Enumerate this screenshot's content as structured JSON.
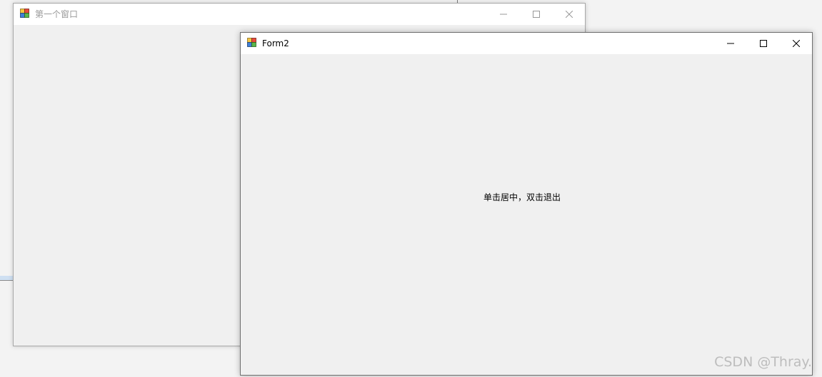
{
  "windows": {
    "first": {
      "title": "第一个窗口"
    },
    "form2": {
      "title": "Form2",
      "label": "单击居中，双击退出"
    }
  },
  "icons": {
    "app": "winforms-app-icon",
    "minimize": "minimize-icon",
    "maximize": "maximize-icon",
    "close": "close-icon"
  },
  "colors": {
    "titlebar": "#ffffff",
    "client": "#f0f0f0",
    "inactive_text": "#999999",
    "active_text": "#000000"
  },
  "watermark": "CSDN @Thray."
}
